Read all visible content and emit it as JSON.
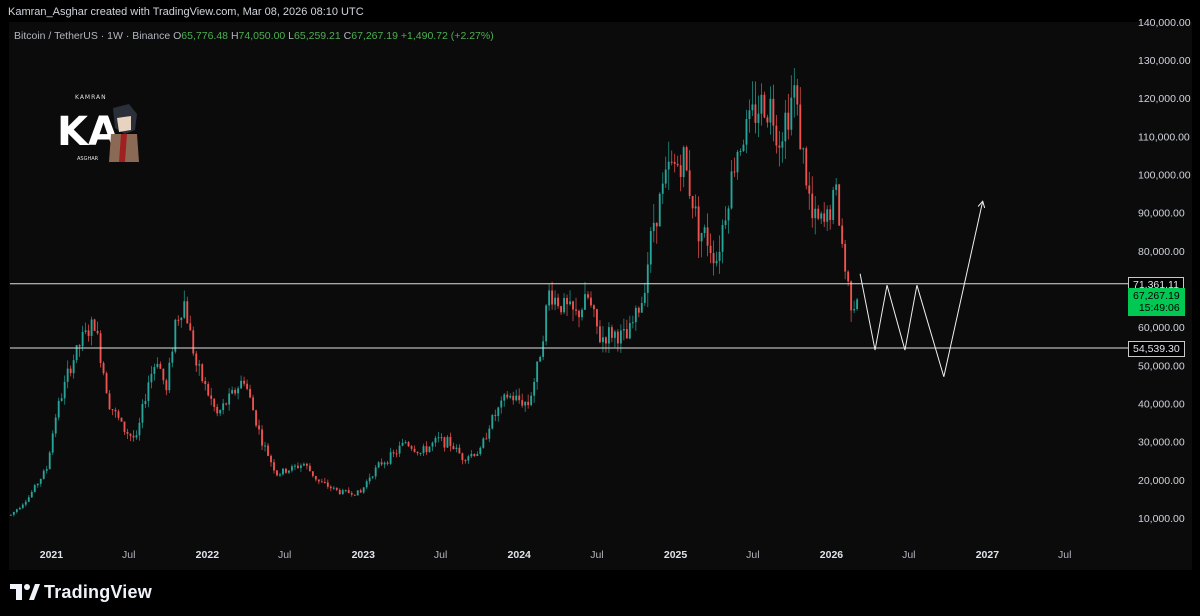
{
  "header": {
    "attribution": "Kamran_Asghar created with TradingView.com, Mar 08, 2026 08:10 UTC"
  },
  "legend": {
    "symbol": "Bitcoin / TetherUS · 1W · Binance",
    "open_label": "O",
    "open": "65,776.48",
    "high_label": "H",
    "high": "74,050.00",
    "low_label": "L",
    "low": "65,259.21",
    "close_label": "C",
    "close": "67,267.19",
    "change": "+1,490.72 (+2.27%)"
  },
  "price_tags": {
    "upper_level": "71,361.11",
    "last_price": "67,267.19",
    "countdown": "15:49:06",
    "lower_level": "54,539.30"
  },
  "logo": {
    "top_text": "KAMRAN",
    "mark": "KA",
    "bottom_text": "ASGHAR"
  },
  "footer": {
    "brand": "TradingView"
  },
  "colors": {
    "up": "#26a69a",
    "up_bright": "#4caf50",
    "down": "#ef5350",
    "level_line": "#e0e0e0",
    "price_tag": "#00c853"
  },
  "chart_data": {
    "type": "candlestick",
    "title": "Bitcoin / TetherUS · 1W · Binance",
    "interval": "1W",
    "xlabel": "",
    "ylabel": "",
    "y_axis_position": "right",
    "ylim": [
      0,
      140000
    ],
    "y_ticks": [
      "10,000.00",
      "20,000.00",
      "30,000.00",
      "40,000.00",
      "50,000.00",
      "60,000.00",
      "70,000.00",
      "80,000.00",
      "90,000.00",
      "100,000.00",
      "110,000.00",
      "120,000.00",
      "130,000.00",
      "140,000.00"
    ],
    "x_ticks": [
      "2021",
      "Jul",
      "2022",
      "Jul",
      "2023",
      "Jul",
      "2024",
      "Jul",
      "2025",
      "Jul",
      "2026",
      "Jul",
      "2027",
      "Jul"
    ],
    "x_tick_dates": [
      "2021-01-01",
      "2021-07-01",
      "2022-01-01",
      "2022-07-01",
      "2023-01-01",
      "2023-07-01",
      "2024-01-01",
      "2024-07-01",
      "2025-01-01",
      "2025-07-01",
      "2026-01-01",
      "2026-07-01",
      "2027-01-01",
      "2027-07-01"
    ],
    "x_range": [
      "2020-09-26",
      "2027-10-15"
    ],
    "price_path": [
      [
        "2020-09-28",
        10800
      ],
      [
        "2020-11-09",
        15500
      ],
      [
        "2020-12-21",
        23000
      ],
      [
        "2021-01-11",
        37000
      ],
      [
        "2021-02-15",
        50000
      ],
      [
        "2021-03-15",
        57000
      ],
      [
        "2021-04-12",
        61000
      ],
      [
        "2021-05-17",
        40000
      ],
      [
        "2021-06-21",
        33000
      ],
      [
        "2021-07-19",
        30500
      ],
      [
        "2021-08-16",
        46000
      ],
      [
        "2021-09-06",
        52000
      ],
      [
        "2021-09-27",
        43000
      ],
      [
        "2021-10-18",
        61500
      ],
      [
        "2021-11-08",
        66500
      ],
      [
        "2021-12-06",
        50000
      ],
      [
        "2022-01-24",
        37000
      ],
      [
        "2022-03-28",
        46500
      ],
      [
        "2022-05-09",
        30000
      ],
      [
        "2022-06-13",
        21500
      ],
      [
        "2022-07-18",
        23000
      ],
      [
        "2022-08-15",
        24200
      ],
      [
        "2022-09-19",
        19500
      ],
      [
        "2022-11-07",
        16800
      ],
      [
        "2022-12-26",
        16600
      ],
      [
        "2023-01-16",
        21000
      ],
      [
        "2023-02-13",
        24500
      ],
      [
        "2023-03-13",
        26500
      ],
      [
        "2023-04-10",
        30000
      ],
      [
        "2023-05-15",
        27000
      ],
      [
        "2023-06-26",
        30500
      ],
      [
        "2023-07-24",
        29500
      ],
      [
        "2023-08-21",
        26000
      ],
      [
        "2023-10-02",
        27500
      ],
      [
        "2023-10-23",
        34500
      ],
      [
        "2023-12-04",
        42000
      ],
      [
        "2024-01-22",
        40000
      ],
      [
        "2024-02-12",
        49000
      ],
      [
        "2024-03-11",
        69000
      ],
      [
        "2024-04-08",
        66000
      ],
      [
        "2024-05-13",
        63000
      ],
      [
        "2024-06-10",
        67500
      ],
      [
        "2024-07-08",
        57000
      ],
      [
        "2024-08-05",
        58500
      ],
      [
        "2024-09-09",
        57000
      ],
      [
        "2024-10-14",
        67000
      ],
      [
        "2024-11-11",
        88000
      ],
      [
        "2024-12-16",
        101000
      ],
      [
        "2025-01-20",
        104000
      ],
      [
        "2025-02-24",
        86000
      ],
      [
        "2025-03-17",
        83000
      ],
      [
        "2025-04-07",
        78000
      ],
      [
        "2025-05-05",
        95000
      ],
      [
        "2025-05-26",
        107000
      ],
      [
        "2025-07-14",
        118000
      ],
      [
        "2025-08-11",
        118000
      ],
      [
        "2025-09-01",
        110000
      ],
      [
        "2025-10-06",
        122000
      ],
      [
        "2025-10-20",
        110000
      ],
      [
        "2025-11-17",
        88000
      ],
      [
        "2025-12-15",
        87000
      ],
      [
        "2026-01-12",
        95000
      ],
      [
        "2026-02-02",
        75000
      ],
      [
        "2026-02-16",
        67000
      ],
      [
        "2026-03-02",
        67267
      ]
    ],
    "horizontal_levels": [
      71361.11,
      54539.3
    ],
    "projection_path": [
      [
        "2026-03-09",
        74000
      ],
      [
        "2026-04-13",
        54000
      ],
      [
        "2026-05-11",
        71000
      ],
      [
        "2026-06-22",
        54000
      ],
      [
        "2026-07-20",
        71000
      ],
      [
        "2026-09-21",
        47000
      ],
      [
        "2026-12-21",
        93000
      ]
    ]
  }
}
